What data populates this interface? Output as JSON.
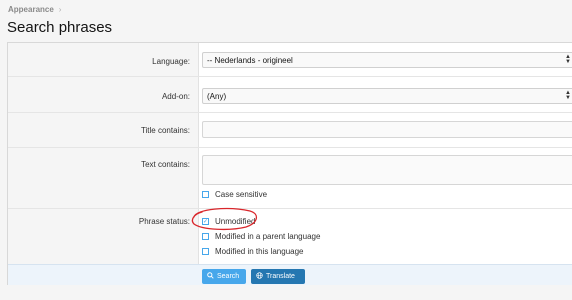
{
  "breadcrumb": {
    "item": "Appearance",
    "separator": "›"
  },
  "page": {
    "title": "Search phrases"
  },
  "form": {
    "language": {
      "label": "Language:",
      "value": "-- Nederlands - origineel"
    },
    "addon": {
      "label": "Add-on:",
      "value": "(Any)"
    },
    "title_contains": {
      "label": "Title contains:",
      "value": ""
    },
    "text_contains": {
      "label": "Text contains:",
      "value": ""
    },
    "case_sensitive": {
      "label": "Case sensitive",
      "checked": false
    },
    "phrase_status": {
      "label": "Phrase status:",
      "options": [
        {
          "label": "Unmodified",
          "checked": true
        },
        {
          "label": "Modified in a parent language",
          "checked": false
        },
        {
          "label": "Modified in this language",
          "checked": false
        }
      ]
    }
  },
  "buttons": {
    "search": "Search",
    "translate": "Translate"
  },
  "colors": {
    "accent": "#47a7eb",
    "primary": "#2577b1",
    "annotation": "#d9262b"
  }
}
